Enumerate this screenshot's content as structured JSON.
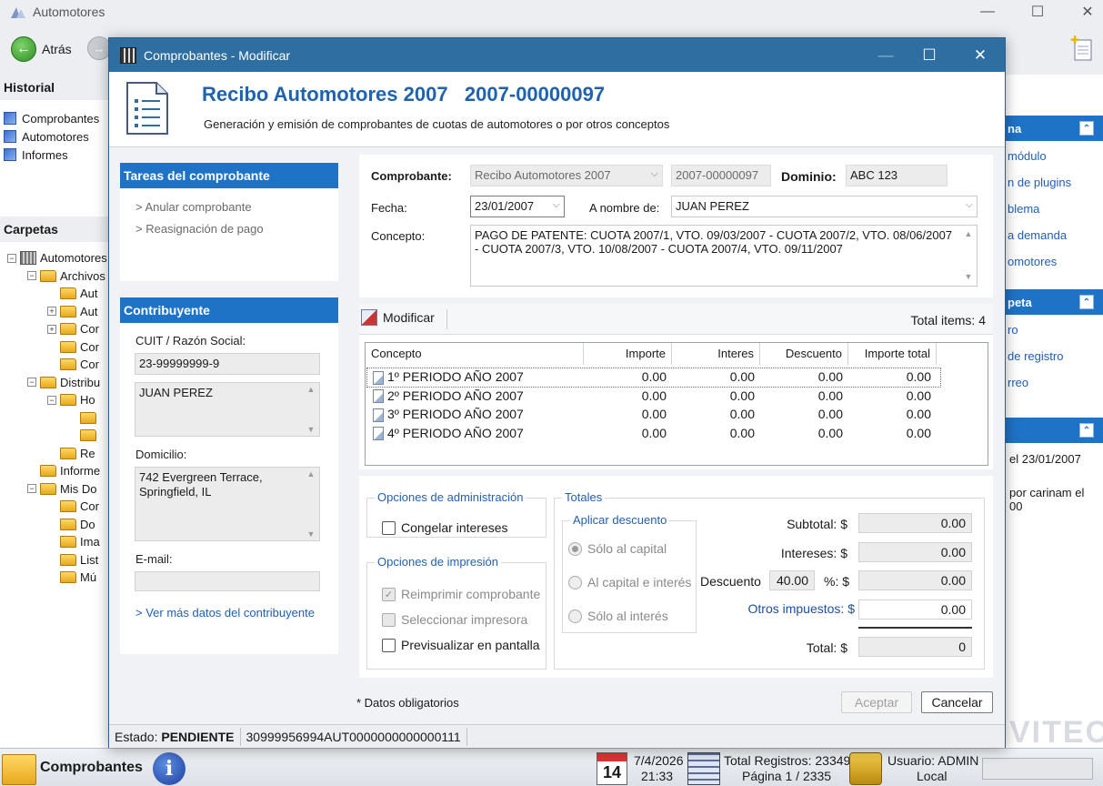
{
  "app": {
    "title": "Automotores",
    "back_label": "Atrás",
    "history_title": "Historial",
    "history_items": [
      "Comprobantes",
      "Automotores",
      "Informes"
    ],
    "folders_title": "Carpetas",
    "tree": [
      {
        "label": "Automotores",
        "depth": 0,
        "exp": "−",
        "icon": "db"
      },
      {
        "label": "Archivos",
        "depth": 1,
        "exp": "−",
        "icon": "folder"
      },
      {
        "label": "Aut",
        "depth": 2,
        "exp": "",
        "icon": "folder"
      },
      {
        "label": "Aut",
        "depth": 2,
        "exp": "+",
        "icon": "folder"
      },
      {
        "label": "Cor",
        "depth": 2,
        "exp": "+",
        "icon": "folder"
      },
      {
        "label": "Cor",
        "depth": 2,
        "exp": "",
        "icon": "folder"
      },
      {
        "label": "Cor",
        "depth": 2,
        "exp": "",
        "icon": "folder"
      },
      {
        "label": "Distribu",
        "depth": 1,
        "exp": "−",
        "icon": "folder"
      },
      {
        "label": "Ho",
        "depth": 2,
        "exp": "−",
        "icon": "folder"
      },
      {
        "label": "",
        "depth": 3,
        "exp": "",
        "icon": "folder"
      },
      {
        "label": "",
        "depth": 3,
        "exp": "",
        "icon": "folder"
      },
      {
        "label": "Re",
        "depth": 2,
        "exp": "",
        "icon": "folder"
      },
      {
        "label": "Informe",
        "depth": 1,
        "exp": "",
        "icon": "folder"
      },
      {
        "label": "Mis Do",
        "depth": 1,
        "exp": "−",
        "icon": "folder"
      },
      {
        "label": "Cor",
        "depth": 2,
        "exp": "",
        "icon": "folder"
      },
      {
        "label": "Do",
        "depth": 2,
        "exp": "",
        "icon": "folder"
      },
      {
        "label": "Ima",
        "depth": 2,
        "exp": "",
        "icon": "folder"
      },
      {
        "label": "List",
        "depth": 2,
        "exp": "",
        "icon": "folder"
      },
      {
        "label": "Mú",
        "depth": 2,
        "exp": "",
        "icon": "folder"
      }
    ],
    "right_panel": {
      "section1_title": "na",
      "section1_links": [
        "módulo",
        "n de plugins",
        "blema",
        "a demanda",
        "omotores"
      ],
      "section2_title": "peta",
      "section2_links": [
        "ro",
        "de registro",
        "rreo"
      ],
      "section3_lines": [
        "el 23/01/2007",
        "por carinam el",
        "00"
      ],
      "brand": "VITEC"
    },
    "status": {
      "module": "Comprobantes",
      "date": "7/4/2026",
      "time": "21:33",
      "calendar_day": "14",
      "total_registros": "Total Registros: 23349",
      "pagina": "Página 1 / 2335",
      "usuario": "Usuario: ADMIN",
      "local": "Local"
    }
  },
  "dialog": {
    "title": "Comprobantes - Modificar",
    "header_title": "Recibo Automotores 2007   2007-00000097",
    "header_subtitle": "Generación y emisión de comprobantes de cuotas de automotores o por otros conceptos",
    "tasks": {
      "title": "Tareas del comprobante",
      "items": [
        "> Anular comprobante",
        "> Reasignación de pago"
      ]
    },
    "contribuyente": {
      "title": "Contribuyente",
      "cuit_label": "CUIT / Razón Social:",
      "cuit": "23-99999999-9",
      "name": "JUAN PEREZ",
      "domicilio_label": "Domicilio:",
      "domicilio": "742 Evergreen Terrace, Springfield, IL",
      "email_label": "E-mail:",
      "email": "",
      "more_link": "> Ver más datos del contribuyente"
    },
    "form": {
      "comprobante_label": "Comprobante:",
      "comprobante": "Recibo Automotores 2007",
      "numero": "2007-00000097",
      "dominio_label": "Dominio:",
      "dominio": "ABC 123",
      "fecha_label": "Fecha:",
      "fecha": "23/01/2007",
      "nombre_label": "A nombre de:",
      "nombre": "JUAN PEREZ",
      "concepto_label": "Concepto:",
      "concepto": "PAGO DE PATENTE: CUOTA 2007/1, VTO. 09/03/2007 - CUOTA 2007/2, VTO. 08/06/2007 - CUOTA 2007/3, VTO. 10/08/2007 - CUOTA 2007/4, VTO. 09/11/2007"
    },
    "items": {
      "modify_label": "Modificar",
      "total_items": "Total items: 4",
      "columns": [
        "Concepto",
        "Importe",
        "Interes",
        "Descuento",
        "Importe total"
      ],
      "rows": [
        [
          "1º PERIODO AÑO 2007",
          "0.00",
          "0.00",
          "0.00",
          "0.00"
        ],
        [
          "2º PERIODO AÑO 2007",
          "0.00",
          "0.00",
          "0.00",
          "0.00"
        ],
        [
          "3º PERIODO AÑO 2007",
          "0.00",
          "0.00",
          "0.00",
          "0.00"
        ],
        [
          "4º PERIODO AÑO 2007",
          "0.00",
          "0.00",
          "0.00",
          "0.00"
        ]
      ]
    },
    "admin_options": {
      "title": "Opciones de administración",
      "congelar": "Congelar intereses"
    },
    "print_options": {
      "title": "Opciones de impresión",
      "reimprimir": "Reimprimir comprobante",
      "seleccionar": "Seleccionar impresora",
      "previsualizar": "Previsualizar en pantalla"
    },
    "totals": {
      "title": "Totales",
      "discount_title": "Aplicar descuento",
      "radio1": "Sólo al capital",
      "radio2": "Al capital e interés",
      "radio3": "Sólo al interés",
      "subtotal_label": "Subtotal: $",
      "subtotal": "0.00",
      "intereses_label": "Intereses: $",
      "intereses": "0.00",
      "descuento_label": "Descuento",
      "descuento_pct": "40.00",
      "pct_label": "%: $",
      "descuento": "0.00",
      "otros_label": "Otros impuestos: $",
      "otros": "0.00",
      "total_label": "Total: $",
      "total": "0"
    },
    "mandatory_note": "* Datos obligatorios",
    "accept_label": "Aceptar",
    "cancel_label": "Cancelar",
    "status_estado_label": "Estado: ",
    "status_estado": "PENDIENTE",
    "status_code": "30999956994AUT0000000000000111"
  }
}
